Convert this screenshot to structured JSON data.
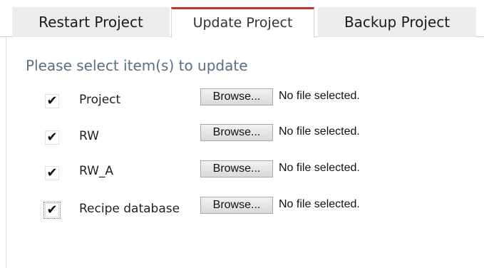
{
  "tabs": [
    {
      "label": "Restart Project",
      "active": false
    },
    {
      "label": "Update Project",
      "active": true
    },
    {
      "label": "Backup Project",
      "active": false
    }
  ],
  "colors": {
    "active_tab_accent": "#c0392b",
    "heading": "#5b7080",
    "inactive_tab_bg": "#ececec"
  },
  "main": {
    "heading": "Please select item(s) to update",
    "items": [
      {
        "label": "Project",
        "checked": true,
        "browse_label": "Browse...",
        "file_status": "No file selected."
      },
      {
        "label": "RW",
        "checked": true,
        "browse_label": "Browse...",
        "file_status": "No file selected."
      },
      {
        "label": "RW_A",
        "checked": true,
        "browse_label": "Browse...",
        "file_status": "No file selected."
      },
      {
        "label": "Recipe database",
        "checked": true,
        "browse_label": "Browse...",
        "file_status": "No file selected."
      }
    ]
  },
  "icons": {
    "checkmark": "checkmark-icon"
  }
}
